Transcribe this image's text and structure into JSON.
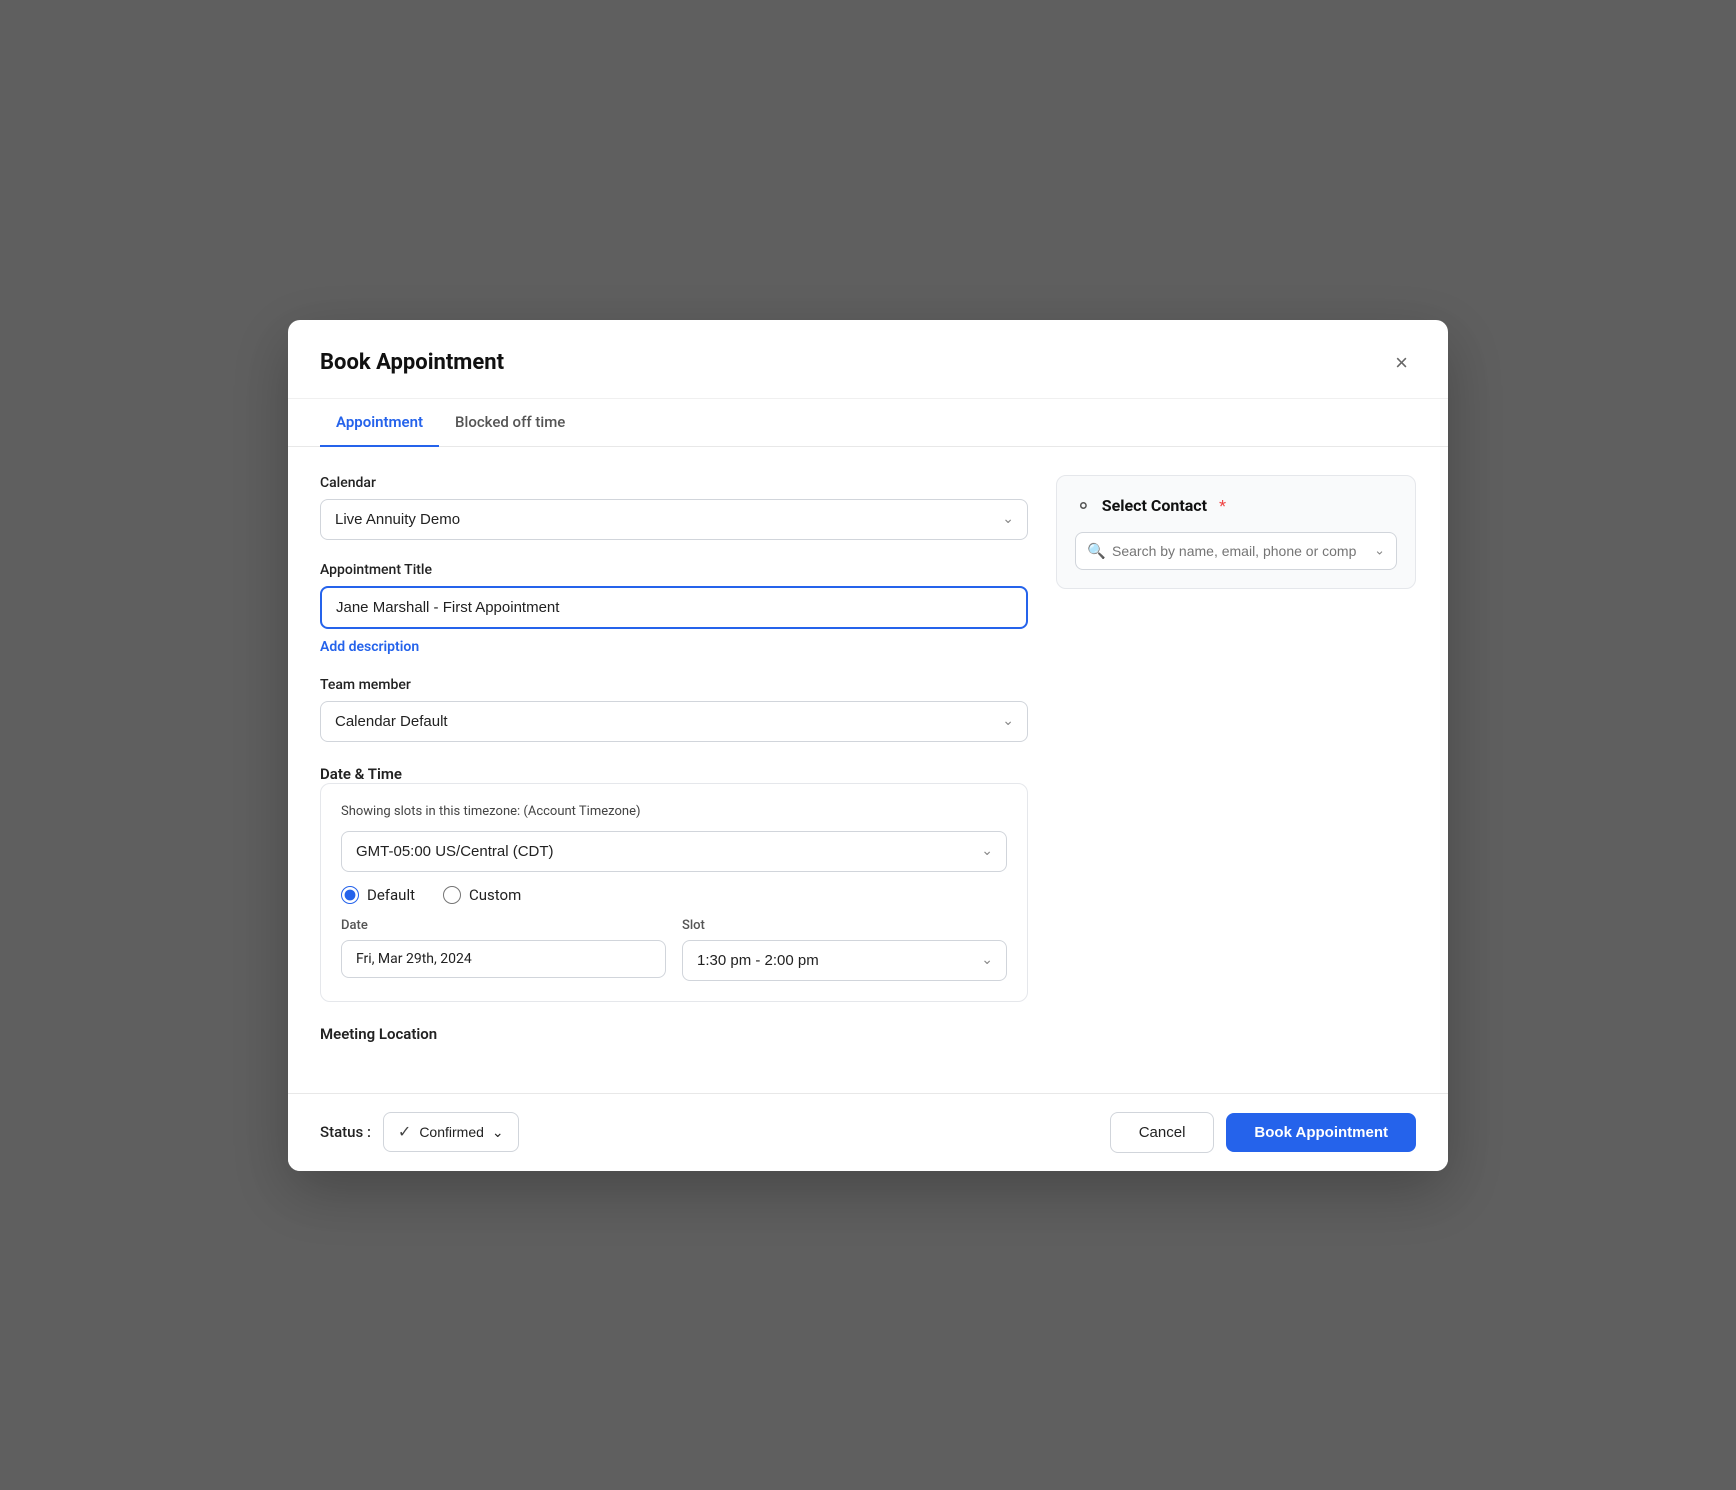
{
  "modal": {
    "title": "Book Appointment",
    "close_label": "×"
  },
  "tabs": [
    {
      "id": "appointment",
      "label": "Appointment",
      "active": true
    },
    {
      "id": "blocked",
      "label": "Blocked off time",
      "active": false
    }
  ],
  "form": {
    "calendar_label": "Calendar",
    "calendar_value": "Live Annuity Demo",
    "appointment_title_label": "Appointment Title",
    "appointment_title_value": "Jane Marshall - First Appointment",
    "add_description_label": "Add description",
    "team_member_label": "Team member",
    "team_member_value": "Calendar Default",
    "date_time_label": "Date & Time",
    "timezone_text": "Showing slots in this timezone: (Account Timezone)",
    "timezone_value": "GMT-05:00 US/Central (CDT)",
    "radio_default_label": "Default",
    "radio_custom_label": "Custom",
    "date_label": "Date",
    "date_value": "Fri, Mar 29th, 2024",
    "slot_label": "Slot",
    "slot_value": "1:30 pm - 2:00 pm",
    "meeting_location_label": "Meeting Location"
  },
  "right_panel": {
    "select_contact_title": "Select Contact",
    "required_indicator": "*",
    "search_placeholder": "Search by name, email, phone or compa"
  },
  "footer": {
    "status_label": "Status :",
    "status_value": "Confirmed",
    "cancel_label": "Cancel",
    "book_label": "Book Appointment"
  }
}
